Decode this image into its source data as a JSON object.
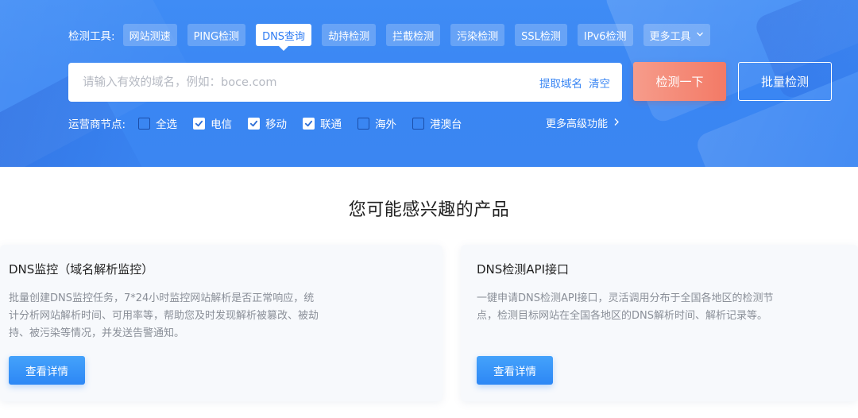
{
  "tools": {
    "label": "检测工具:",
    "tabs": [
      {
        "label": "网站测速",
        "active": false
      },
      {
        "label": "PING检测",
        "active": false
      },
      {
        "label": "DNS查询",
        "active": true
      },
      {
        "label": "劫持检测",
        "active": false
      },
      {
        "label": "拦截检测",
        "active": false
      },
      {
        "label": "污染检测",
        "active": false
      },
      {
        "label": "SSL检测",
        "active": false
      },
      {
        "label": "IPv6检测",
        "active": false
      }
    ],
    "more_label": "更多工具"
  },
  "search": {
    "placeholder": "请输入有效的域名，例如：boce.com",
    "value": "",
    "extract_label": "提取域名",
    "clear_label": "清空",
    "check_button": "检测一下",
    "batch_button": "批量检测"
  },
  "carriers": {
    "label": "运营商节点:",
    "options": [
      {
        "label": "全选",
        "checked": false
      },
      {
        "label": "电信",
        "checked": true
      },
      {
        "label": "移动",
        "checked": true
      },
      {
        "label": "联通",
        "checked": true
      },
      {
        "label": "海外",
        "checked": false
      },
      {
        "label": "港澳台",
        "checked": false
      }
    ],
    "more_label": "更多高级功能"
  },
  "products": {
    "title": "您可能感兴趣的产品",
    "cards": [
      {
        "title": "DNS监控（域名解析监控）",
        "desc": "批量创建DNS监控任务，7*24小时监控网站解析是否正常响应，统计分析网站解析时间、可用率等，帮助您及时发现解析被篡改、被劫持、被污染等情况，并发送告警通知。",
        "button": "查看详情"
      },
      {
        "title": "DNS检测API接口",
        "desc": "一键申请DNS检测API接口，灵活调用分布于全国各地区的检测节点，检测目标网站在全国各地区的DNS解析时间、解析记录等。",
        "button": "查看详情"
      }
    ]
  },
  "colors": {
    "hero_blue": "#3a86f3",
    "accent_orange": "#f37a66",
    "link_blue": "#3a86f3"
  }
}
